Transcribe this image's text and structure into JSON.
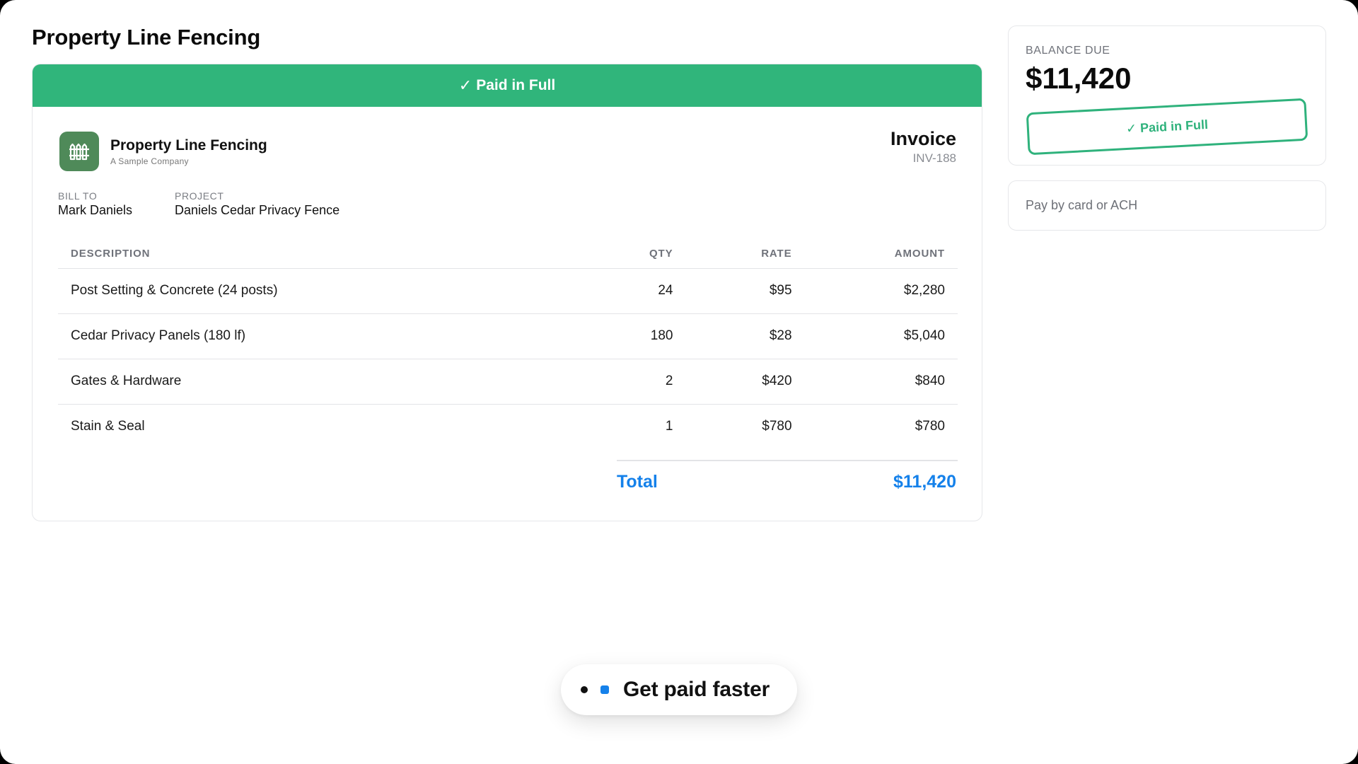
{
  "page": {
    "title": "Property Line Fencing"
  },
  "invoice": {
    "banner": {
      "check": "✓",
      "label": "Paid in Full"
    },
    "company": {
      "name": "Property Line Fencing",
      "subtitle": "A Sample Company",
      "logo_icon": "fence-icon"
    },
    "title": "Invoice",
    "number": "INV-188",
    "bill_to": {
      "label": "BILL TO",
      "value": "Mark Daniels"
    },
    "project": {
      "label": "PROJECT",
      "value": "Daniels Cedar Privacy Fence"
    },
    "table": {
      "headers": {
        "description": "DESCRIPTION",
        "qty": "QTY",
        "rate": "RATE",
        "amount": "AMOUNT"
      },
      "rows": [
        {
          "description": "Post Setting & Concrete (24 posts)",
          "qty": "24",
          "rate": "$95",
          "amount": "$2,280"
        },
        {
          "description": "Cedar Privacy Panels (180 lf)",
          "qty": "180",
          "rate": "$28",
          "amount": "$5,040"
        },
        {
          "description": "Gates & Hardware",
          "qty": "2",
          "rate": "$420",
          "amount": "$840"
        },
        {
          "description": "Stain & Seal",
          "qty": "1",
          "rate": "$780",
          "amount": "$780"
        }
      ]
    },
    "total": {
      "label": "Total",
      "value": "$11,420"
    }
  },
  "balance": {
    "label": "BALANCE DUE",
    "amount": "$11,420",
    "stamp": {
      "check": "✓",
      "label": "Paid in Full"
    }
  },
  "payment": {
    "label": "Pay by card or ACH"
  },
  "pill": {
    "label": "Get paid faster"
  },
  "colors": {
    "paid_green": "#30b57b",
    "accent_blue": "#1581ea",
    "logo_green": "#4f8a59"
  }
}
